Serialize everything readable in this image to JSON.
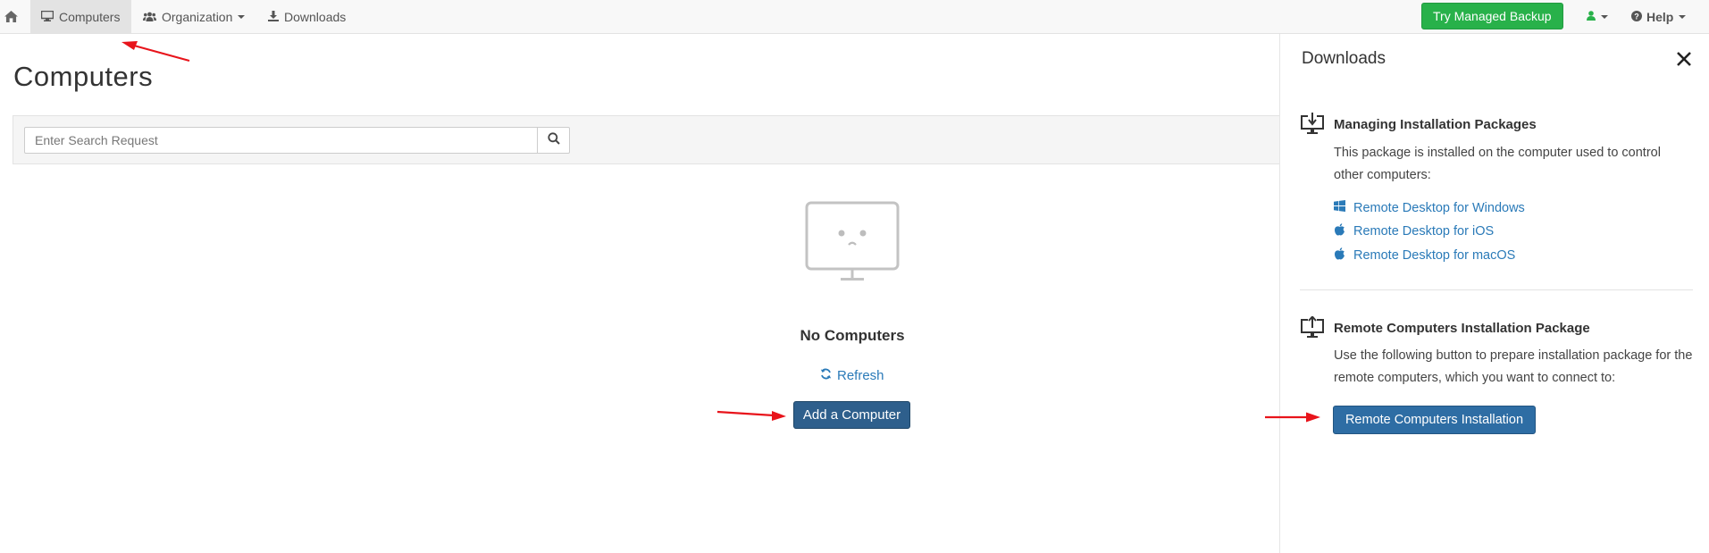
{
  "navbar": {
    "items": [
      {
        "label": "Computers",
        "icon": "monitor-icon",
        "active": true
      },
      {
        "label": "Organization",
        "icon": "users-icon",
        "active": false,
        "dropdown": true
      },
      {
        "label": "Downloads",
        "icon": "download-icon",
        "active": false
      }
    ],
    "try_button": "Try Managed Backup",
    "help_label": "Help"
  },
  "main": {
    "title": "Computers",
    "search": {
      "placeholder": "Enter Search Request",
      "value": ""
    },
    "empty": {
      "title": "No Computers",
      "refresh_label": "Refresh",
      "add_button": "Add a Computer"
    }
  },
  "panel": {
    "title": "Downloads",
    "managing": {
      "title": "Managing Installation Packages",
      "text": "This package is installed on the computer used to control other computers:",
      "links": [
        {
          "label": "Remote Desktop for Windows",
          "icon": "windows-icon"
        },
        {
          "label": "Remote Desktop for iOS",
          "icon": "apple-icon"
        },
        {
          "label": "Remote Desktop for macOS",
          "icon": "apple-icon"
        }
      ]
    },
    "remote": {
      "title": "Remote Computers Installation Package",
      "text": "Use the following button to prepare installation package for the remote computers, which you want to connect to:",
      "button": "Remote Computers Installation"
    }
  },
  "colors": {
    "accent_green": "#28b14a",
    "primary_blue": "#2e6da4",
    "dark_blue": "#2e5f8c",
    "link_blue": "#2a7ab8",
    "annotation_red": "#e8141b"
  }
}
